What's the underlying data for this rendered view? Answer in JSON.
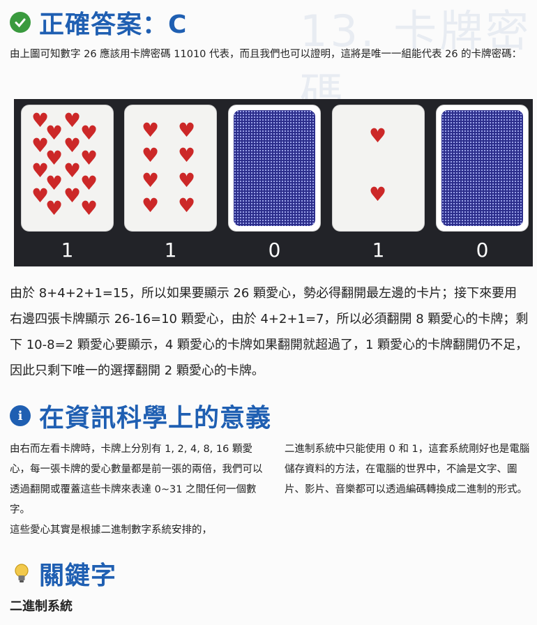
{
  "answer_heading": "正確答案：C",
  "intro": "由上圖可知數字 26 應該用卡牌密碼 11010 代表，而且我們也可以證明，這將是唯一一組能代表 26 的卡牌密碼：",
  "cards": [
    {
      "hearts": 16,
      "face": "up",
      "bit": "1"
    },
    {
      "hearts": 8,
      "face": "up",
      "bit": "1"
    },
    {
      "hearts": 4,
      "face": "down",
      "bit": "0"
    },
    {
      "hearts": 2,
      "face": "up",
      "bit": "1"
    },
    {
      "hearts": 1,
      "face": "down",
      "bit": "0"
    }
  ],
  "explanation": "由於 8+4+2+1=15，所以如果要顯示 26 顆愛心，勢必得翻開最左邊的卡片；接下來要用右邊四張卡牌顯示 26-16=10 顆愛心，由於 4+2+1=7，所以必須翻開 8 顆愛心的卡牌；剩下 10-8=2 顆愛心要顯示，4 顆愛心的卡牌如果翻開就超過了，1 顆愛心的卡牌翻開仍不足，因此只剩下唯一的選擇翻開 2 顆愛心的卡牌。",
  "meaning_heading": "在資訊科學上的意義",
  "meaning_left_1": "由右而左看卡牌時，卡牌上分別有 1, 2, 4, 8, 16 顆愛心，每一張卡牌的愛心數量都是前一張的兩倍，我們可以透過翻開或覆蓋這些卡牌來表達 0~31 之間任何一個數字。",
  "meaning_left_2": "這些愛心其實是根據二進制數字系統安排的，",
  "meaning_right": "二進制系統中只能使用 0 和 1，這套系統剛好也是電腦儲存資料的方法，在電腦的世界中，不論是文字、圖片、影片、音樂都可以透過編碼轉換成二進制的形式。",
  "keyword_heading": "關鍵字",
  "keyword": "二進制系統",
  "background_text": "13. 卡牌密碼",
  "colors": {
    "heading": "#1f5fb2",
    "check": "#3a9a3e",
    "info": "#1f5fb2",
    "heart": "#cc2828",
    "card_back": "#2a2c8a"
  },
  "icons": [
    "check-circle-icon",
    "info-circle-icon",
    "lightbulb-icon"
  ]
}
